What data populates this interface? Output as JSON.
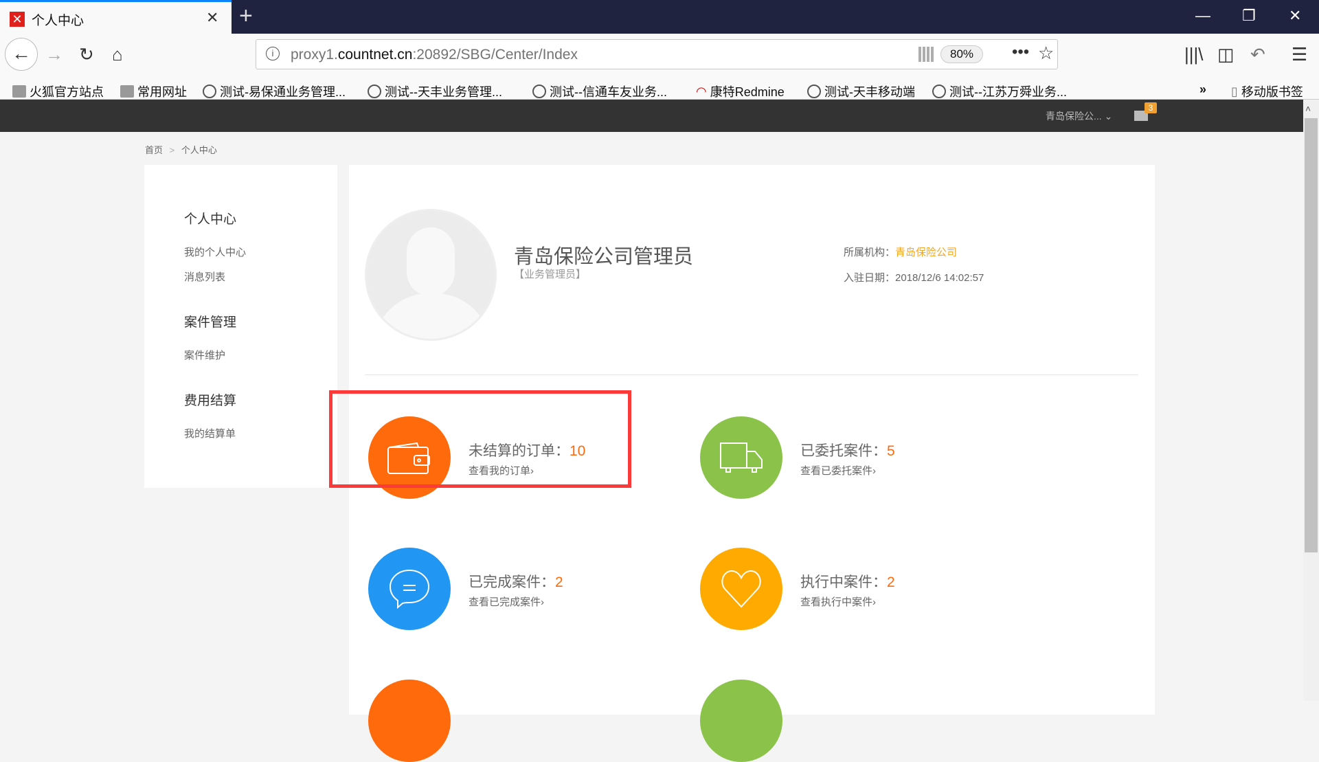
{
  "browser": {
    "tab_title": "个人中心",
    "url_host_prefix": "proxy1.",
    "url_host": "countnet.cn",
    "url_path": ":20892/SBG/Center/Index",
    "zoom": "80%",
    "bookmarks": [
      "火狐官方站点",
      "常用网址",
      "测试-易保通业务管理...",
      "测试--天丰业务管理...",
      "测试--信通车友业务...",
      "康特Redmine",
      "测试-天丰移动端",
      "测试--江苏万舜业务..."
    ],
    "mobile_bookmarks": "移动版书签"
  },
  "header": {
    "user": "青岛保险公...",
    "unread": "3"
  },
  "breadcrumb": {
    "home": "首页",
    "sep": ">",
    "current": "个人中心"
  },
  "sidebar": {
    "groups": [
      {
        "title": "个人中心",
        "items": [
          "我的个人中心",
          "消息列表"
        ]
      },
      {
        "title": "案件管理",
        "items": [
          "案件维护"
        ]
      },
      {
        "title": "费用结算",
        "items": [
          "我的结算单"
        ]
      }
    ]
  },
  "profile": {
    "name": "青岛保险公司管理员",
    "role": "【业务管理员】",
    "org_label": "所属机构：",
    "org": "青岛保险公司",
    "date_label": "入驻日期：",
    "date": "2018/12/6 14:02:57"
  },
  "cards": [
    {
      "title": "未结算的订单：",
      "count": "10",
      "link": "查看我的订单",
      "color": "#ff6a0c",
      "icon": "wallet"
    },
    {
      "title": "已委托案件：",
      "count": "5",
      "link": "查看已委托案件",
      "color": "#8bc34a",
      "icon": "truck"
    },
    {
      "title": "已完成案件：",
      "count": "2",
      "link": "查看已完成案件",
      "color": "#2196f3",
      "icon": "chat"
    },
    {
      "title": "执行中案件：",
      "count": "2",
      "link": "查看执行中案件",
      "color": "#ffaa00",
      "icon": "heart"
    }
  ],
  "arrow": "›"
}
